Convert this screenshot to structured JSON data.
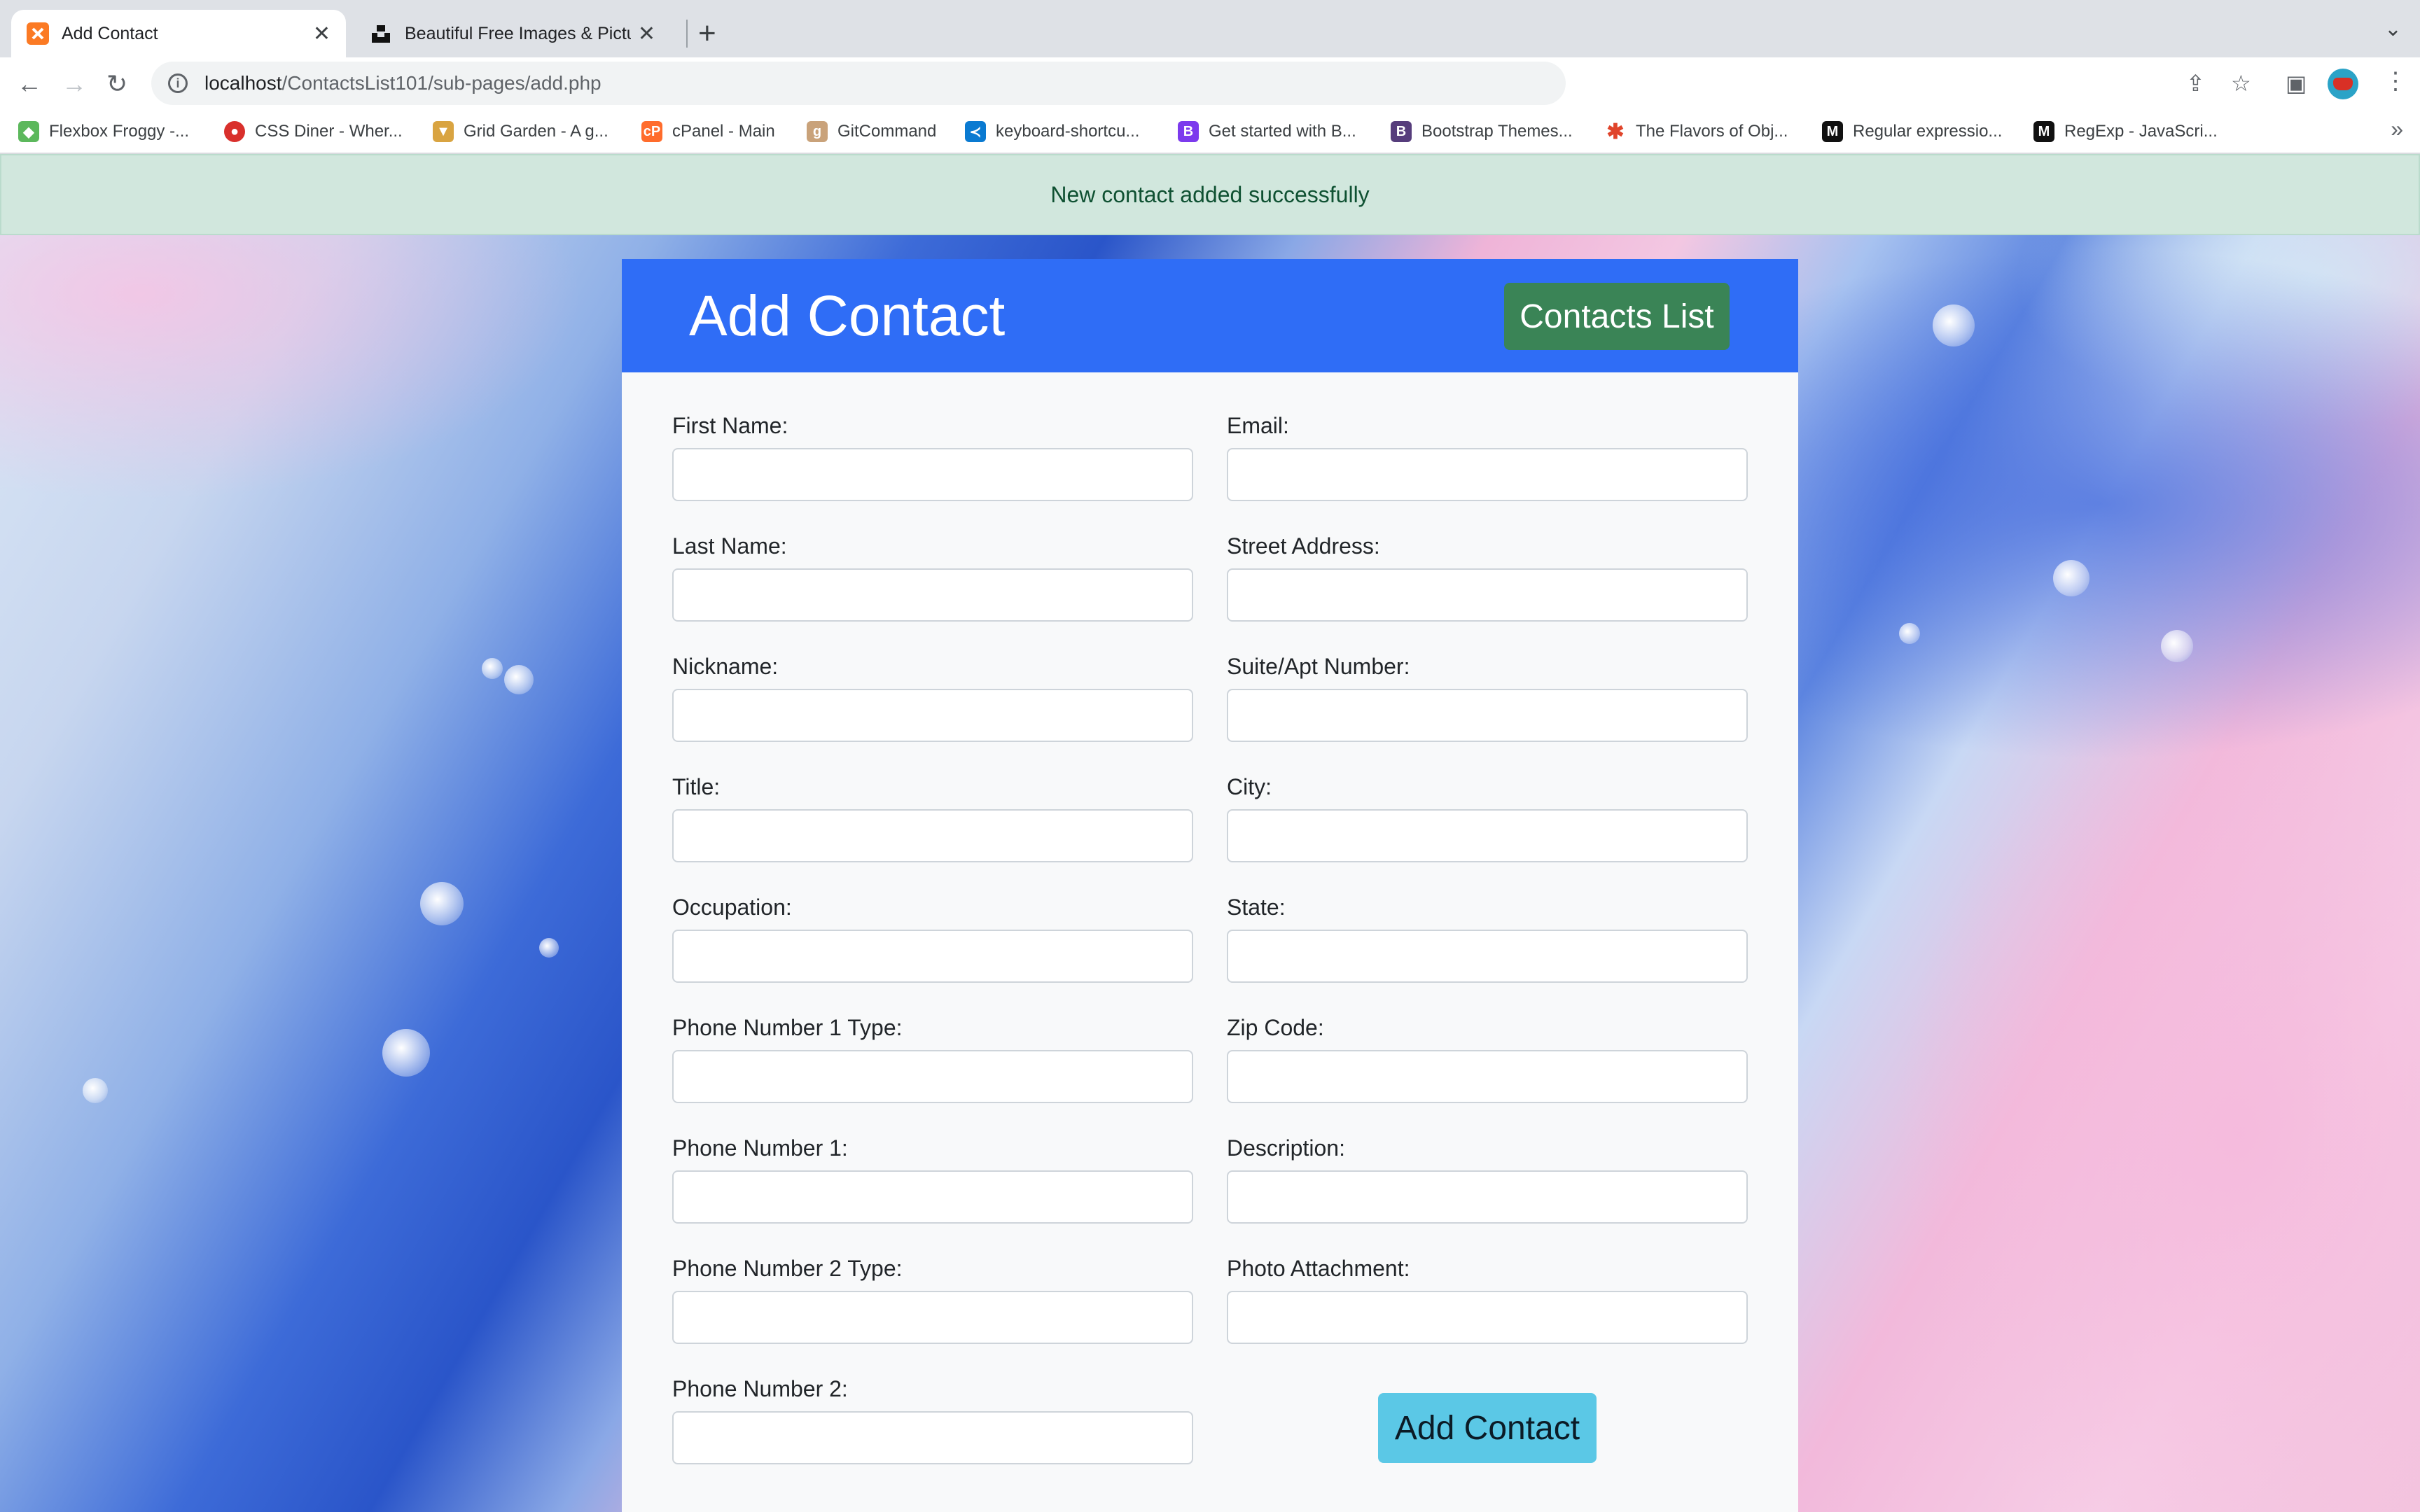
{
  "browser": {
    "tabs": [
      {
        "title": "Add Contact",
        "active": true,
        "favicon": "xampp-icon"
      },
      {
        "title": "Beautiful Free Images & Pictures",
        "active": false,
        "favicon": "unsplash-icon"
      }
    ],
    "url_host": "localhost",
    "url_path": "/ContactsList101/sub-pages/add.php",
    "bookmarks": [
      {
        "label": "Flexbox Froggy -...",
        "icon": "frog-icon",
        "color": "#5cb85c"
      },
      {
        "label": "CSS Diner - Wher...",
        "icon": "plate-icon",
        "color": "#d9302c"
      },
      {
        "label": "Grid Garden - A g...",
        "icon": "carrot-icon",
        "color": "#d9a441"
      },
      {
        "label": "cPanel - Main",
        "icon": "cpanel-icon",
        "color": "#ff6c2c"
      },
      {
        "label": "GitCommand",
        "icon": "git-icon",
        "color": "#c9a27a"
      },
      {
        "label": "keyboard-shortcu...",
        "icon": "vscode-icon",
        "color": "#0a7ad1"
      },
      {
        "label": "Get started with B...",
        "icon": "bootstrap-icon",
        "color": "#7c3aed"
      },
      {
        "label": "Bootstrap Themes...",
        "icon": "bootstrap-icon",
        "color": "#563d7c"
      },
      {
        "label": "The Flavors of Obj...",
        "icon": "asterisk-icon",
        "color": "#e0442b"
      },
      {
        "label": "Regular expressio...",
        "icon": "mdn-icon",
        "color": "#111111"
      },
      {
        "label": "RegExp - JavaScri...",
        "icon": "mdn-icon",
        "color": "#111111"
      }
    ]
  },
  "alert": {
    "message": "New contact added successfully"
  },
  "page": {
    "title": "Add Contact",
    "contacts_list_button": "Contacts List",
    "submit_button": "Add Contact"
  },
  "form": {
    "left": [
      {
        "label": "First Name:",
        "value": ""
      },
      {
        "label": "Last Name:",
        "value": ""
      },
      {
        "label": "Nickname:",
        "value": ""
      },
      {
        "label": "Title:",
        "value": ""
      },
      {
        "label": "Occupation:",
        "value": ""
      },
      {
        "label": "Phone Number 1 Type:",
        "value": ""
      },
      {
        "label": "Phone Number 1:",
        "value": ""
      },
      {
        "label": "Phone Number 2 Type:",
        "value": ""
      },
      {
        "label": "Phone Number 2:",
        "value": ""
      }
    ],
    "right": [
      {
        "label": "Email:",
        "value": ""
      },
      {
        "label": "Street Address:",
        "value": ""
      },
      {
        "label": "Suite/Apt Number:",
        "value": ""
      },
      {
        "label": "City:",
        "value": ""
      },
      {
        "label": "State:",
        "value": ""
      },
      {
        "label": "Zip Code:",
        "value": ""
      },
      {
        "label": "Description:",
        "value": ""
      },
      {
        "label": "Photo Attachment:",
        "value": ""
      }
    ]
  },
  "colors": {
    "header": "#2f6df6",
    "contacts_list_button": "#3a8456",
    "submit_button": "#5bc8e6",
    "alert_bg": "#d1e7dd",
    "alert_text": "#0f5132"
  }
}
